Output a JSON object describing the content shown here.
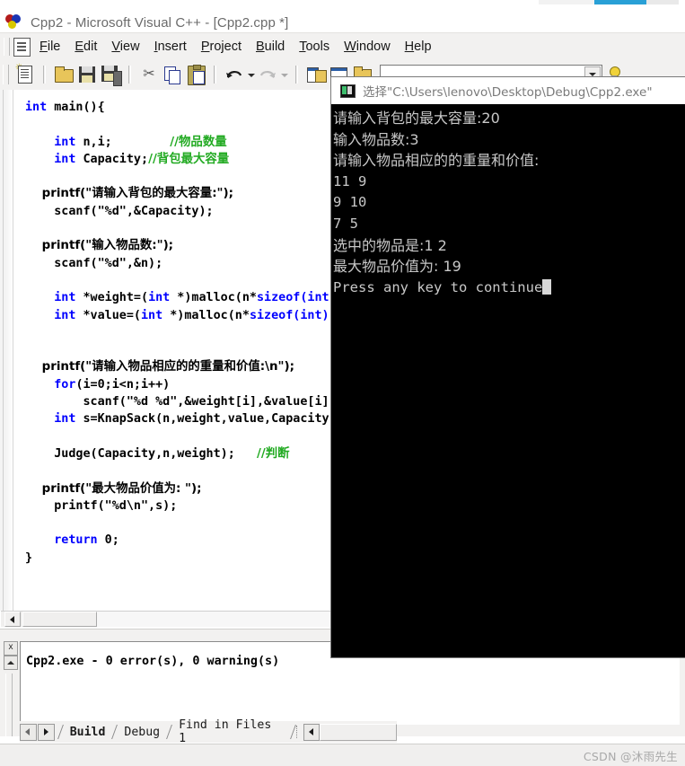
{
  "window": {
    "title": "Cpp2 - Microsoft Visual C++ - [Cpp2.cpp *]",
    "app_icon": "visual-cpp-icon"
  },
  "menubar": {
    "items": [
      {
        "label": "File",
        "mnemonic": "F"
      },
      {
        "label": "Edit",
        "mnemonic": "E"
      },
      {
        "label": "View",
        "mnemonic": "V"
      },
      {
        "label": "Insert",
        "mnemonic": "I"
      },
      {
        "label": "Project",
        "mnemonic": "P"
      },
      {
        "label": "Build",
        "mnemonic": "B"
      },
      {
        "label": "Tools",
        "mnemonic": "T"
      },
      {
        "label": "Window",
        "mnemonic": "W"
      },
      {
        "label": "Help",
        "mnemonic": "H"
      }
    ]
  },
  "toolbar": {
    "buttons": [
      "new-file-icon",
      "open-file-icon",
      "save-icon",
      "save-all-icon",
      "cut-icon",
      "copy-icon",
      "paste-icon",
      "undo-icon",
      "redo-icon",
      "workspace-icon",
      "output-window-icon",
      "folder-icon"
    ],
    "search_combo_value": "",
    "search_combo_placeholder": ""
  },
  "editor": {
    "lines": [
      [
        {
          "t": "int ",
          "c": "kw"
        },
        {
          "t": "main(){",
          "c": ""
        }
      ],
      [
        {
          "t": "",
          "c": ""
        }
      ],
      [
        {
          "t": "    ",
          "c": ""
        },
        {
          "t": "int",
          "c": "kw"
        },
        {
          "t": " n,i;        ",
          "c": ""
        },
        {
          "t": "//物品数量",
          "c": "cm cjk"
        }
      ],
      [
        {
          "t": "    ",
          "c": ""
        },
        {
          "t": "int",
          "c": "kw"
        },
        {
          "t": " Capacity;",
          "c": ""
        },
        {
          "t": "//背包最大容量",
          "c": "cm cjk"
        }
      ],
      [
        {
          "t": "",
          "c": ""
        }
      ],
      [
        {
          "t": "    printf(\"请输入背包的最大容量:\");",
          "c": "cjk"
        }
      ],
      [
        {
          "t": "    scanf(\"%d\",&Capacity);",
          "c": ""
        }
      ],
      [
        {
          "t": "",
          "c": ""
        }
      ],
      [
        {
          "t": "    printf(\"输入物品数:\");",
          "c": "cjk"
        }
      ],
      [
        {
          "t": "    scanf(\"%d\",&n);",
          "c": ""
        }
      ],
      [
        {
          "t": "",
          "c": ""
        }
      ],
      [
        {
          "t": "    ",
          "c": ""
        },
        {
          "t": "int",
          "c": "kw"
        },
        {
          "t": " *weight=(",
          "c": ""
        },
        {
          "t": "int",
          "c": "kw"
        },
        {
          "t": " *)malloc(n*",
          "c": ""
        },
        {
          "t": "sizeof(int));",
          "c": "kw"
        }
      ],
      [
        {
          "t": "    ",
          "c": ""
        },
        {
          "t": "int",
          "c": "kw"
        },
        {
          "t": " *value=(",
          "c": ""
        },
        {
          "t": "int",
          "c": "kw"
        },
        {
          "t": " *)malloc(n*",
          "c": ""
        },
        {
          "t": "sizeof(int));",
          "c": "kw"
        }
      ],
      [
        {
          "t": "",
          "c": ""
        }
      ],
      [
        {
          "t": "",
          "c": ""
        }
      ],
      [
        {
          "t": "    printf(\"请输入物品相应的的重量和价值:\\n\");",
          "c": "cjk"
        }
      ],
      [
        {
          "t": "    ",
          "c": ""
        },
        {
          "t": "for",
          "c": "kw"
        },
        {
          "t": "(i=0;i<n;i++)",
          "c": ""
        }
      ],
      [
        {
          "t": "        scanf(\"%d %d\",&weight[i],&value[i]);",
          "c": ""
        }
      ],
      [
        {
          "t": "    ",
          "c": ""
        },
        {
          "t": "int",
          "c": "kw"
        },
        {
          "t": " s=KnapSack(n,weight,value,Capacity);",
          "c": ""
        }
      ],
      [
        {
          "t": "",
          "c": ""
        }
      ],
      [
        {
          "t": "    Judge(Capacity,n,weight);   ",
          "c": ""
        },
        {
          "t": "//判断",
          "c": "cm cjk"
        }
      ],
      [
        {
          "t": "",
          "c": ""
        }
      ],
      [
        {
          "t": "    printf(\"最大物品价值为: \");",
          "c": "cjk"
        }
      ],
      [
        {
          "t": "    printf(\"%d\\n\",s);",
          "c": ""
        }
      ],
      [
        {
          "t": "",
          "c": ""
        }
      ],
      [
        {
          "t": "    ",
          "c": ""
        },
        {
          "t": "return",
          "c": "kw"
        },
        {
          "t": " 0;",
          "c": ""
        }
      ],
      [
        {
          "t": "}",
          "c": ""
        }
      ]
    ],
    "colors": {
      "keyword": "#0000ff",
      "comment": "#22aa22",
      "text": "#000000",
      "background": "#ffffff"
    }
  },
  "console": {
    "title": "选择\"C:\\Users\\lenovo\\Desktop\\Debug\\Cpp2.exe\"",
    "icon": "console-app-icon",
    "lines": [
      "请输入背包的最大容量:20",
      "输入物品数:3",
      "请输入物品相应的的重量和价值:",
      "11 9",
      "9 10",
      "7 5",
      "选中的物品是:1 2",
      "最大物品价值为: 19",
      "Press any key to continue"
    ],
    "colors": {
      "background": "#000000",
      "text": "#c8c8c8"
    }
  },
  "output": {
    "text": "Cpp2.exe - 0 error(s), 0 warning(s)",
    "close_label": "x",
    "tabs": [
      {
        "label": "Build",
        "active": true
      },
      {
        "label": "Debug",
        "active": false
      },
      {
        "label": "Find in Files 1",
        "active": false
      }
    ]
  },
  "watermark": {
    "text": "CSDN @沐雨先生"
  },
  "accent": {
    "progress_blue": "#29a0d6"
  }
}
